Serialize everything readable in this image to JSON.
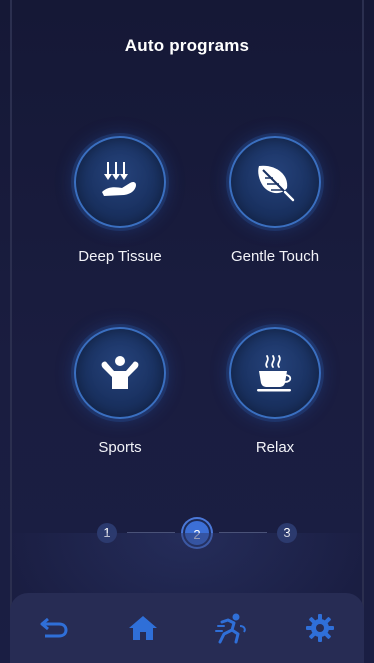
{
  "header": {
    "title": "Auto programs"
  },
  "programs": [
    {
      "label": "Deep Tissue",
      "icon": "deep-tissue-icon"
    },
    {
      "label": "Gentle Touch",
      "icon": "feather-icon"
    },
    {
      "label": "Sports",
      "icon": "person-arms-up-icon"
    },
    {
      "label": "Relax",
      "icon": "steaming-cup-icon"
    }
  ],
  "pager": {
    "pages": [
      "1",
      "2",
      "3"
    ],
    "current": "2"
  },
  "bottom_nav": [
    {
      "icon": "back-arrow-icon"
    },
    {
      "icon": "home-icon"
    },
    {
      "icon": "massage-figure-icon"
    },
    {
      "icon": "gear-icon"
    }
  ],
  "colors": {
    "background": "#151836",
    "accent": "#3c6fd6",
    "nav_icon": "#2f6fd8",
    "nav_bar": "#272c54"
  }
}
